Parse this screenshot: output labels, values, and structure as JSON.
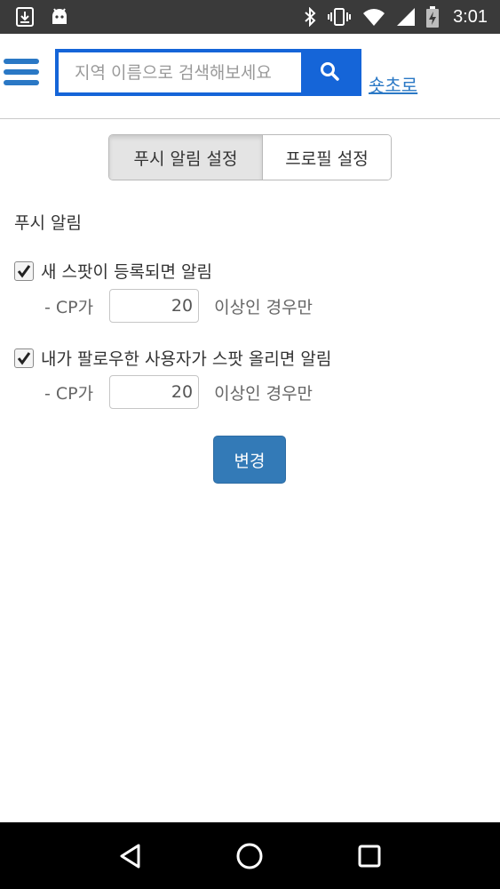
{
  "status_bar": {
    "time": "3:01",
    "icons": [
      "download-icon",
      "android-icon",
      "bluetooth-icon",
      "vibrate-icon",
      "wifi-icon",
      "signal-icon",
      "battery-charging-icon"
    ]
  },
  "header": {
    "search_placeholder": "지역 이름으로 검색해보세요",
    "shortcut_label": "숏초로",
    "menu_icon": "hamburger-menu-icon",
    "search_icon": "search-icon",
    "accent_color": "#1565d8"
  },
  "tabs": [
    {
      "label": "푸시 알림 설정",
      "active": true
    },
    {
      "label": "프로필 설정",
      "active": false
    }
  ],
  "push": {
    "title": "푸시 알림",
    "options": [
      {
        "label": "새 스팟이 등록되면 알림",
        "checked": true,
        "cp_prefix": "- CP가",
        "cp_value": "20",
        "cp_suffix": "이상인 경우만"
      },
      {
        "label": "내가 팔로우한 사용자가 스팟 올리면 알림",
        "checked": true,
        "cp_prefix": "- CP가",
        "cp_value": "20",
        "cp_suffix": "이상인 경우만"
      }
    ],
    "submit_label": "변경"
  },
  "nav_bar": {
    "icons": [
      "back-triangle-icon",
      "home-circle-icon",
      "recents-square-icon"
    ]
  }
}
